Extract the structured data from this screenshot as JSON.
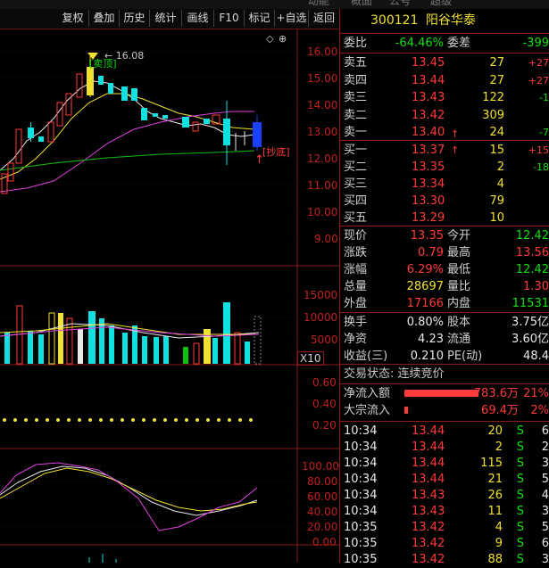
{
  "toolbar": {
    "buttons": [
      "复权",
      "叠加",
      "历史",
      "统计",
      "画线",
      "F10",
      "标记",
      "+自选",
      "返回"
    ]
  },
  "stock": {
    "code": "300121",
    "name": "阳谷华泰"
  },
  "weibi": {
    "label1": "委比",
    "value1": "-64.46%",
    "label2": "委差",
    "value2": "-399"
  },
  "sell": [
    {
      "label": "卖五",
      "price": "13.45",
      "vol": "27",
      "chg": "+27"
    },
    {
      "label": "卖四",
      "price": "13.44",
      "vol": "27",
      "chg": "+27"
    },
    {
      "label": "卖三",
      "price": "13.43",
      "vol": "122",
      "chg": "-1"
    },
    {
      "label": "卖二",
      "price": "13.42",
      "vol": "309",
      "chg": ""
    },
    {
      "label": "卖一",
      "price": "13.40",
      "vol": "24",
      "chg": "-7"
    }
  ],
  "buy": [
    {
      "label": "买一",
      "price": "13.37",
      "vol": "15",
      "chg": "+15"
    },
    {
      "label": "买二",
      "price": "13.35",
      "vol": "2",
      "chg": "-18"
    },
    {
      "label": "买三",
      "price": "13.34",
      "vol": "4",
      "chg": ""
    },
    {
      "label": "买四",
      "price": "13.30",
      "vol": "79",
      "chg": ""
    },
    {
      "label": "买五",
      "price": "13.29",
      "vol": "10",
      "chg": ""
    }
  ],
  "quote": [
    {
      "l1": "现价",
      "v1": "13.35",
      "c1": "red",
      "l2": "今开",
      "v2": "12.42",
      "c2": "grn"
    },
    {
      "l1": "涨跌",
      "v1": "0.79",
      "c1": "red",
      "l2": "最高",
      "v2": "13.56",
      "c2": "red"
    },
    {
      "l1": "涨幅",
      "v1": "6.29%",
      "c1": "red",
      "l2": "最低",
      "v2": "12.42",
      "c2": "grn"
    },
    {
      "l1": "总量",
      "v1": "28697",
      "c1": "yel",
      "l2": "量比",
      "v2": "1.30",
      "c2": "red"
    },
    {
      "l1": "外盘",
      "v1": "17166",
      "c1": "red",
      "l2": "内盘",
      "v2": "11531",
      "c2": "grn"
    }
  ],
  "finance": [
    {
      "l1": "换手",
      "v1": "0.80%",
      "l2": "股本",
      "v2": "3.75亿"
    },
    {
      "l1": "净资",
      "v1": "4.23",
      "l2": "流通",
      "v2": "3.60亿"
    },
    {
      "l1": "收益(三)",
      "v1": "0.210",
      "l2": "PE(动)",
      "v2": "48.4"
    }
  ],
  "trade_status": "交易状态: 连续竞价",
  "flow": [
    {
      "label": "净流入额",
      "value": "783.6万",
      "pct": "21%",
      "bar": 0.83
    },
    {
      "label": "大宗流入",
      "value": "69.4万",
      "pct": "2%",
      "bar": 0.04
    }
  ],
  "ticks": [
    {
      "t": "10:34",
      "p": "13.44",
      "v": "20",
      "s": "S",
      "n": "6"
    },
    {
      "t": "10:34",
      "p": "13.44",
      "v": "2",
      "s": "S",
      "n": "2"
    },
    {
      "t": "10:34",
      "p": "13.44",
      "v": "115",
      "s": "S",
      "n": "3"
    },
    {
      "t": "10:34",
      "p": "13.44",
      "v": "21",
      "s": "S",
      "n": "5"
    },
    {
      "t": "10:34",
      "p": "13.43",
      "v": "26",
      "s": "S",
      "n": "4"
    },
    {
      "t": "10:34",
      "p": "13.43",
      "v": "11",
      "s": "S",
      "n": "3"
    },
    {
      "t": "10:35",
      "p": "13.42",
      "v": "4",
      "s": "S",
      "n": "5"
    },
    {
      "t": "10:35",
      "p": "13.42",
      "v": "9",
      "s": "S",
      "n": "6"
    },
    {
      "t": "10:35",
      "p": "13.42",
      "v": "88",
      "s": "S",
      "n": "3"
    }
  ],
  "chart": {
    "price_axis": [
      "16.00",
      "15.00",
      "14.00",
      "13.00",
      "12.00",
      "11.00",
      "10.00",
      "9.00"
    ],
    "high_label": "16.08",
    "sell_tag": "卖顶",
    "buy_tag": "抄底",
    "vol_axis": [
      "15000",
      "10000",
      "5000"
    ],
    "vol_unit": "X10",
    "ind1_axis": [
      "0.60",
      "0.40",
      "0.20"
    ],
    "ind2_axis": [
      "100.00",
      "80.00",
      "60.00",
      "40.00",
      "20.00",
      "0.00"
    ]
  },
  "colors": {
    "up": "#ff3a3a",
    "down": "#10e0e0",
    "accent": "#f0e030",
    "border": "#8b1a1a"
  }
}
